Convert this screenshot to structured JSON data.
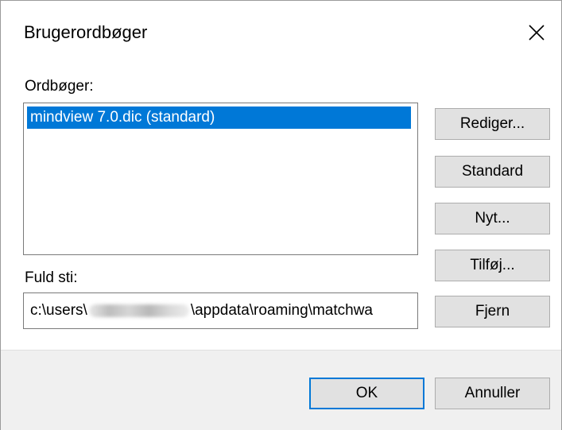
{
  "dialog": {
    "title": "Brugerordbøger"
  },
  "dictionaries": {
    "label": "Ordbøger:",
    "items": [
      "mindview 7.0.dic (standard)"
    ]
  },
  "path": {
    "label": "Fuld sti:",
    "prefix": "c:\\users\\",
    "suffix": "\\appdata\\roaming\\matchwa"
  },
  "side_buttons": {
    "edit": "Rediger...",
    "default": "Standard",
    "new": "Nyt...",
    "add": "Tilføj...",
    "remove": "Fjern"
  },
  "footer": {
    "ok": "OK",
    "cancel": "Annuller"
  },
  "colors": {
    "selection": "#0078d7",
    "default_button_border": "#0078d7"
  }
}
